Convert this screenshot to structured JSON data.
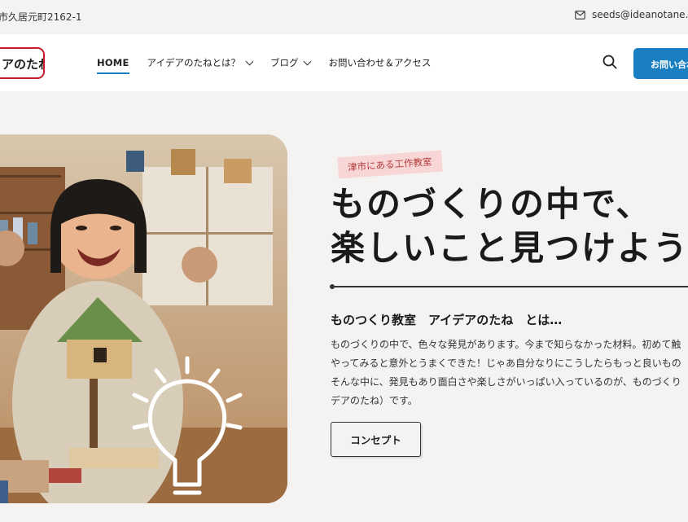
{
  "topbar": {
    "address": "市久居元町2162-1",
    "email": "seeds@ideanotane.jp",
    "mail_icon": "mail-icon"
  },
  "header": {
    "logo_text": "アのたね",
    "nav": [
      {
        "label": "HOME"
      },
      {
        "label": "アイデアのたねとは？"
      },
      {
        "label": "ブログ"
      },
      {
        "label": "お問い合わせ＆アクセス"
      }
    ],
    "search_icon": "search-icon",
    "contact_button": "お問い合わせ"
  },
  "hero": {
    "tag": "津市にある工作教室",
    "headline_line1": "ものづくりの中で、",
    "headline_line2": "楽しいこと見つけよう",
    "subheading": "ものつくり教室　アイデアのたね　とは…",
    "body_lines": [
      "ものづくりの中で、色々な発見があります。今まで知らなかった材料。初めて触",
      "やってみると意外とうまくできた！じゃあ自分なりにこうしたらもっと良いもの",
      "そんな中に、発見もあり面白さや楽しさがいっぱい入っているのが、ものづくり",
      "デアのたね）です。"
    ],
    "concept_button": "コンセプト"
  },
  "colors": {
    "accent": "#1a7fc1",
    "logo_border": "#c41d2a",
    "tag_bg": "#f8d6d6",
    "tag_text": "#b33a3a",
    "page_bg": "#f4f3f2"
  }
}
